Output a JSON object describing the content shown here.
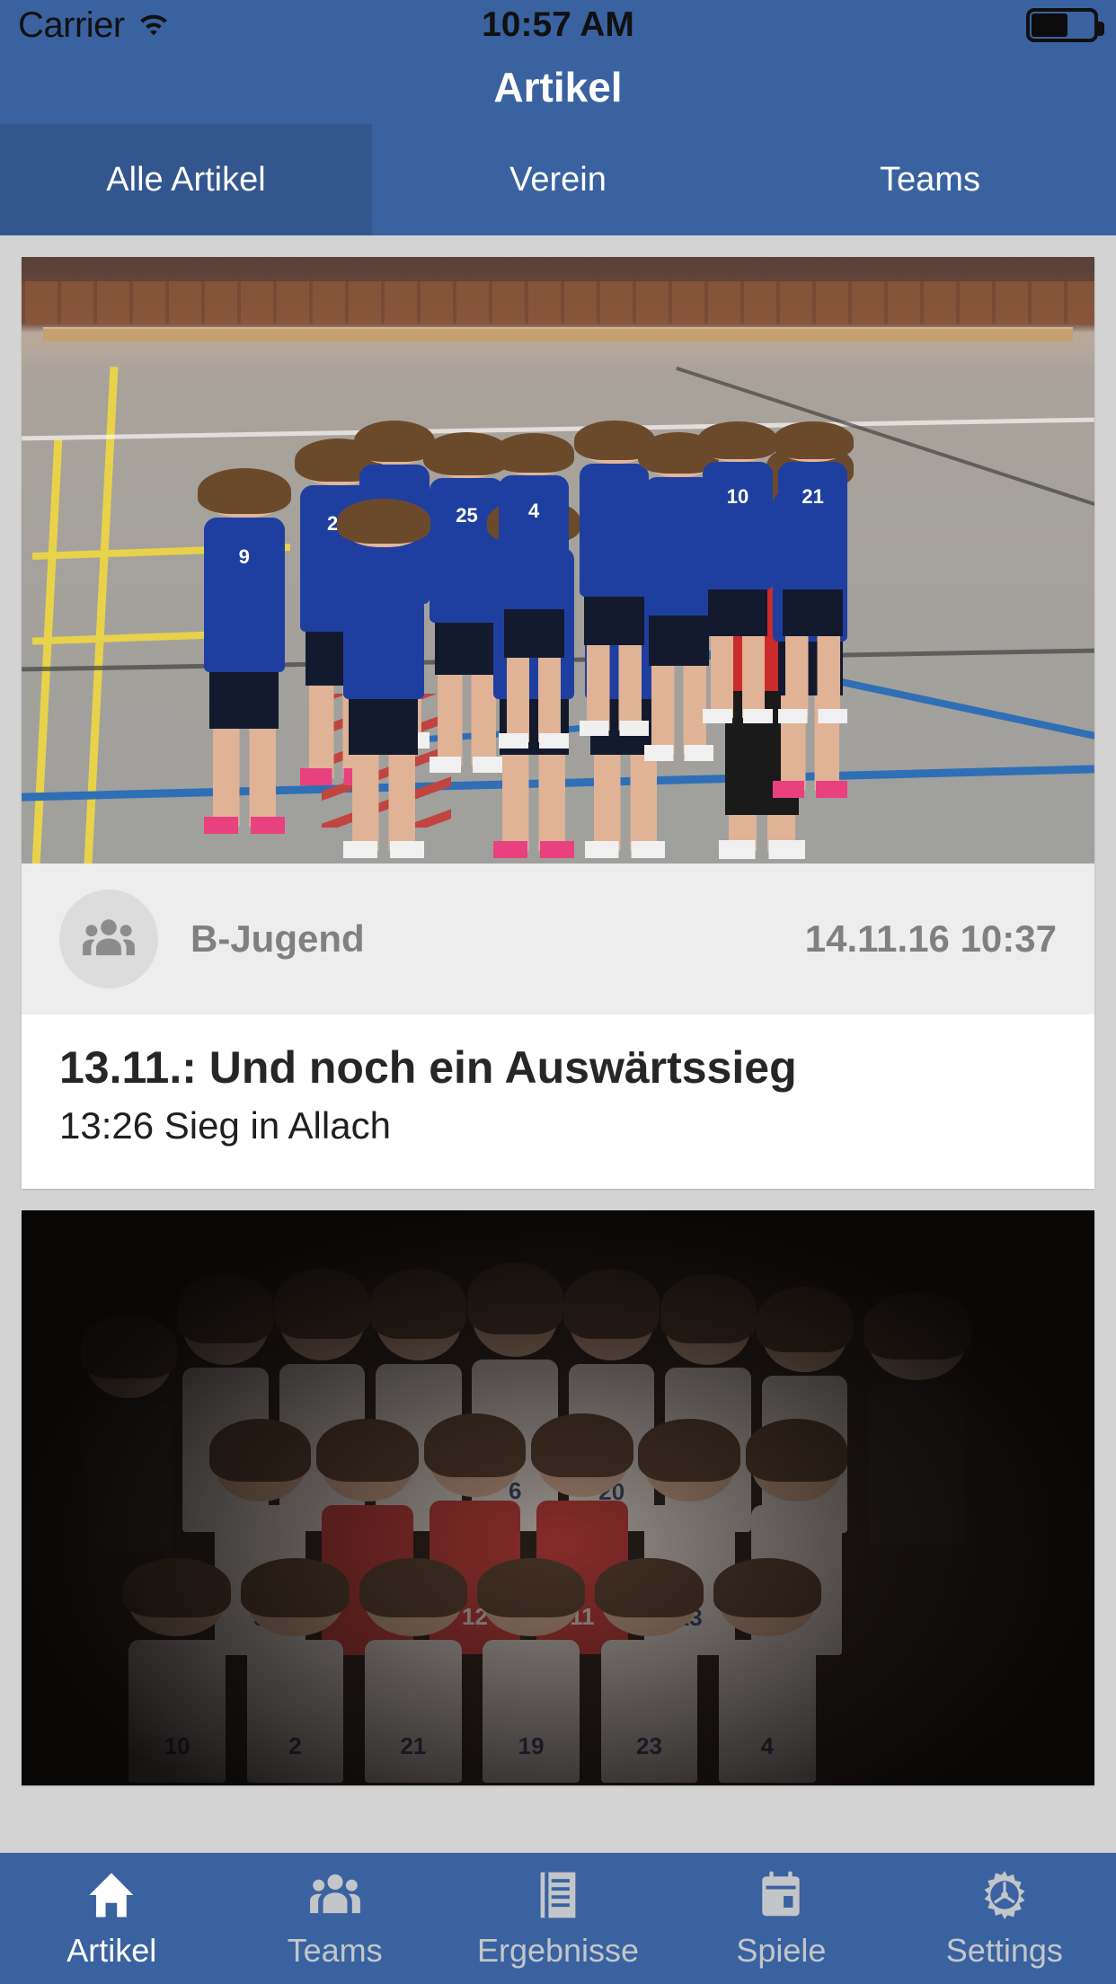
{
  "status_bar": {
    "carrier": "Carrier",
    "wifi_icon": "wifi-icon",
    "time": "10:57 AM",
    "battery_icon": "battery-icon",
    "battery_level_percent": 55
  },
  "nav_header": {
    "title": "Artikel",
    "background_color": "#3a62a0"
  },
  "segmented_tabs": {
    "active_index": 0,
    "active_background_color": "#33568e",
    "items": [
      {
        "label": "Alle Artikel"
      },
      {
        "label": "Verein"
      },
      {
        "label": "Teams"
      }
    ]
  },
  "articles": [
    {
      "photo_alt": "handball-team-photo-gym",
      "team_icon": "group-icon",
      "team": "B-Jugend",
      "date": "14.11.16 10:37",
      "title": "13.11.: Und noch ein Auswärtssieg",
      "subtitle": "13:26 Sieg in Allach"
    },
    {
      "photo_alt": "handball-team-portrait-dark",
      "team_icon": "group-icon",
      "team": "",
      "date": "",
      "title": "",
      "subtitle": ""
    }
  ],
  "bottom_tabs": {
    "active_index": 0,
    "items": [
      {
        "label": "Artikel",
        "icon": "home-icon"
      },
      {
        "label": "Teams",
        "icon": "group-icon"
      },
      {
        "label": "Ergebnisse",
        "icon": "list-document-icon"
      },
      {
        "label": "Spiele",
        "icon": "calendar-icon"
      },
      {
        "label": "Settings",
        "icon": "gear-icon"
      }
    ]
  },
  "colors": {
    "brand_blue": "#3a62a0",
    "brand_blue_dark": "#33568e",
    "page_background": "#d3d3d3",
    "card_background": "#ffffff",
    "meta_background": "#ededed",
    "meta_text": "#808080",
    "inactive_tab_text": "#c3c6c9"
  }
}
